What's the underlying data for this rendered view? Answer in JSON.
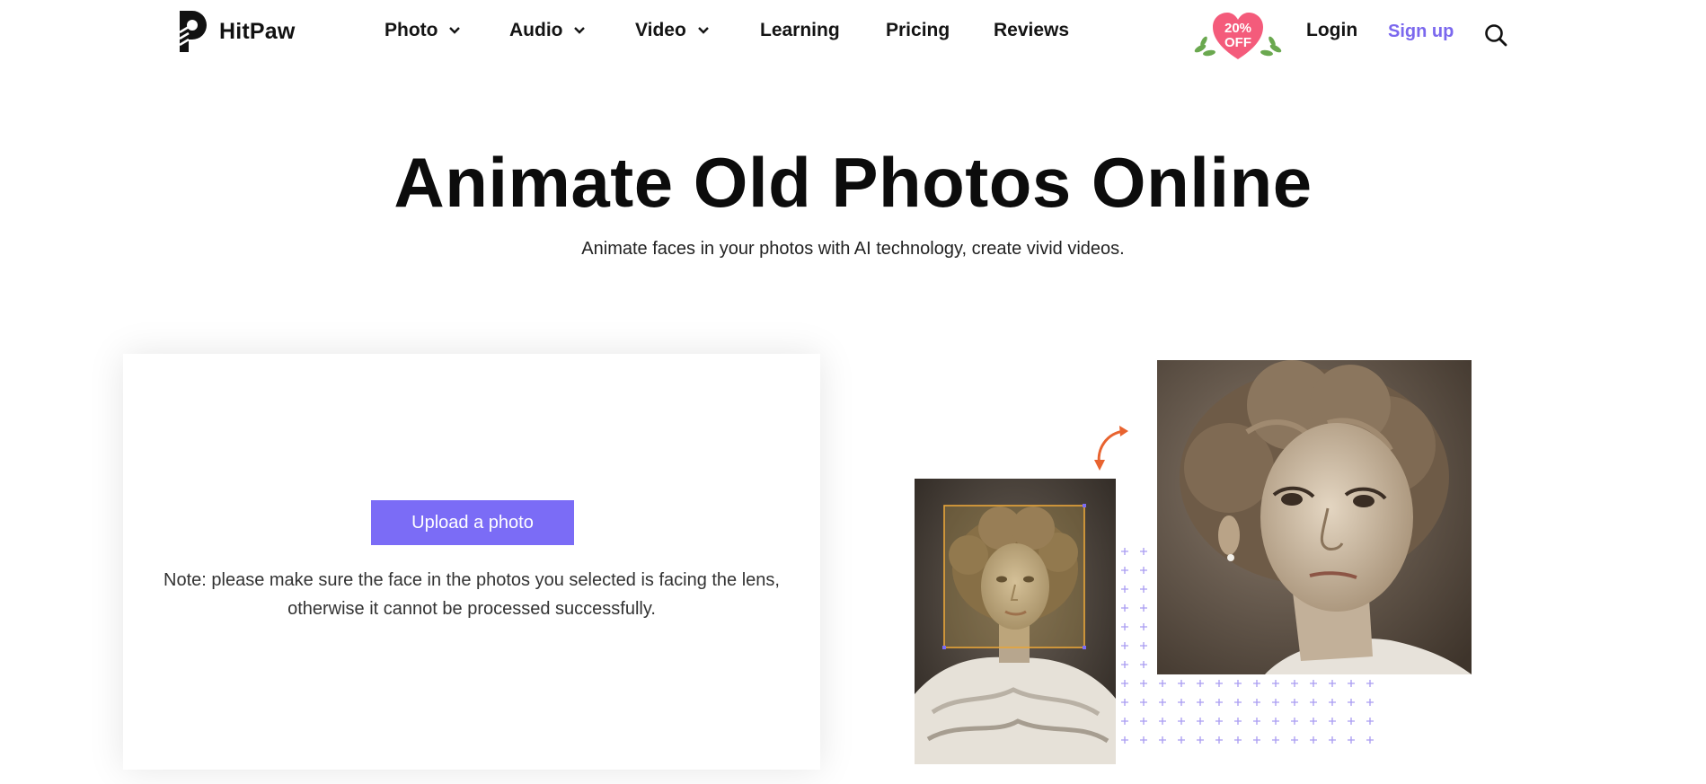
{
  "brand": {
    "name": "HitPaw",
    "logo_icon": "hitpaw-logo-icon"
  },
  "nav": {
    "items": [
      {
        "label": "Photo",
        "dropdown": true
      },
      {
        "label": "Audio",
        "dropdown": true
      },
      {
        "label": "Video",
        "dropdown": true
      },
      {
        "label": "Learning",
        "dropdown": false
      },
      {
        "label": "Pricing",
        "dropdown": false
      },
      {
        "label": "Reviews",
        "dropdown": false
      }
    ]
  },
  "promo": {
    "line1": "20%",
    "line2": "OFF",
    "color": "#f45b7b"
  },
  "header_actions": {
    "login": "Login",
    "signup": "Sign up",
    "search_icon": "search-icon"
  },
  "hero": {
    "title": "Animate Old Photos Online",
    "subtitle": "Animate faces in your photos with AI technology, create vivid videos."
  },
  "upload": {
    "button_label": "Upload a photo",
    "note": "Note: please make sure the face in the photos you selected is facing the lens, otherwise it cannot be processed successfully."
  },
  "colors": {
    "accent": "#7b6cf6",
    "signup": "#7b68ee",
    "arrow": "#e8632f",
    "face_box": "#e8a53a",
    "dots": "#a99cf2"
  }
}
